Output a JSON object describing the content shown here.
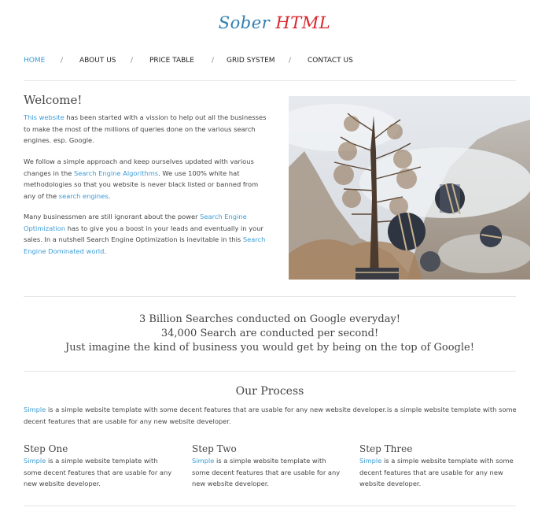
{
  "logo": {
    "part1": "Sober",
    "part2": "HTML"
  },
  "nav": {
    "items": [
      "HOME",
      "ABOUT US",
      "PRICE TABLE",
      "GRID SYSTEM",
      "CONTACT US"
    ],
    "separator": "/"
  },
  "welcome": {
    "title": "Welcome!",
    "p1": {
      "link": "This website",
      "text": " has been started with a vission to help out all the businesses to make the most of the millions of queries done on the various search engines. esp. Google."
    },
    "p2": {
      "t1": "We follow a simple approach and keep ourselves updated with various changes in the ",
      "link1": "Search Engine Algorithms",
      "t2": ". We use 100% white hat methodologies so that you website is never black listed or banned from any of the ",
      "link2": "search engines",
      "t3": "."
    },
    "p3": {
      "t1": "Many businessmen are still ignorant about the power ",
      "link1": "Search Engine Optimization",
      "t2": " has to give you a boost in your leads and eventually in your sales. In a nutshell Search Engine Optimization is inevitable in this ",
      "link2": "Search Engine Dominated world",
      "t3": "."
    }
  },
  "banner": {
    "line1": "3 Billion Searches conducted on Google everyday!",
    "line2": "34,000 Search are conducted per second!",
    "line3": "Just imagine the kind of business you would get by being on the top of Google!"
  },
  "process": {
    "title": "Our Process",
    "intro_link": "Simple",
    "intro_text": " is a simple website template with some decent features that are usable for any new website developer.is a simple website template with some decent features that are usable for any new website developer.",
    "steps": [
      {
        "title": "Step One",
        "link": "Simple",
        "text": " is a simple website template with some decent features that are usable for any new website developer."
      },
      {
        "title": "Step Two",
        "link": "Simple",
        "text": " is a simple website template with some decent features that are usable for any new website developer."
      },
      {
        "title": "Step Three",
        "link": "Simple",
        "text": " is a simple website template with some decent features that are usable for any new website developer."
      }
    ]
  },
  "colors": {
    "link": "#3a9bd5",
    "logo_blue": "#2f7fb0",
    "logo_red": "#d9262c"
  }
}
